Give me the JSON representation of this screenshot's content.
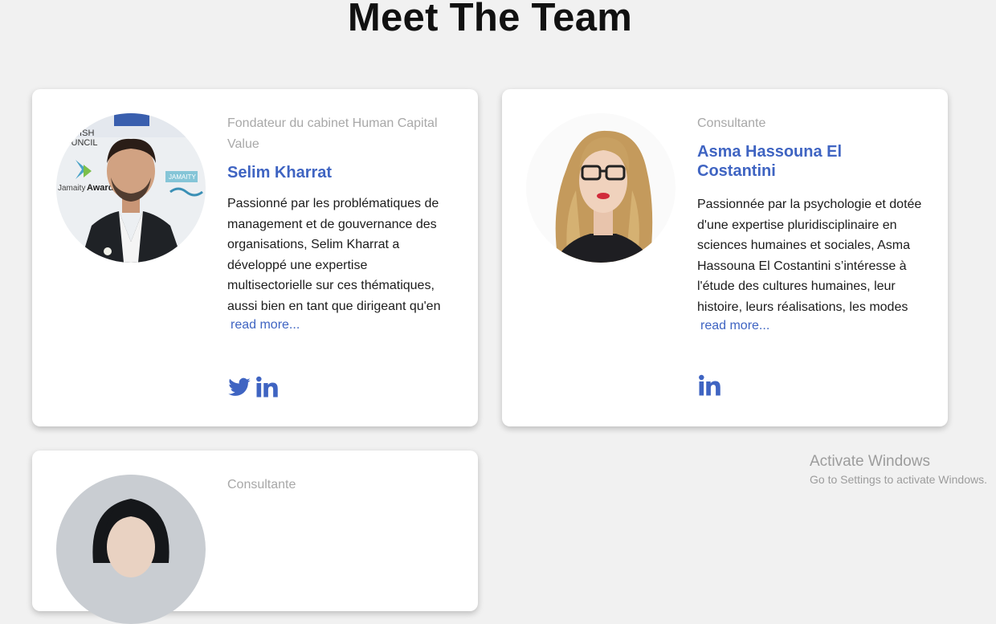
{
  "page": {
    "title": "Meet The Team"
  },
  "team": [
    {
      "role": "Fondateur du cabinet Human Capital Value",
      "name": "Selim Kharrat",
      "bio": "Passionné par les problématiques de management et de gouvernance des organisations, Selim Kharrat a développé une expertise multisectorielle sur ces thématiques, aussi bien en tant que dirigeant qu'en",
      "read_more": "read more...",
      "photo": "portrait-photo-man-dark-suit",
      "photo_text": "BRITISH COUNCIL · Jamaity Awards · JAMAITY",
      "social": [
        "twitter-icon",
        "linkedin-icon"
      ]
    },
    {
      "role": "Consultante",
      "name": "Asma Hassouna El Costantini",
      "bio": "Passionnée par la psychologie et dotée d'une expertise pluridisciplinaire en sciences humaines et sociales, Asma Hassouna El Costantini s’intéresse à l'étude des cultures humaines, leur histoire, leurs réalisations, les modes",
      "read_more": "read more...",
      "photo": "portrait-photo-woman-glasses-blonde",
      "social": [
        "linkedin-icon"
      ]
    },
    {
      "role": "Consultante",
      "photo": "portrait-photo-woman-dark-hair"
    }
  ],
  "watermark": {
    "title": "Activate Windows",
    "subtitle": "Go to Settings to activate Windows."
  },
  "colors": {
    "accent": "#3f64c2",
    "role_text": "#a8a8a8",
    "background": "#f1f1f1",
    "card": "#ffffff"
  }
}
